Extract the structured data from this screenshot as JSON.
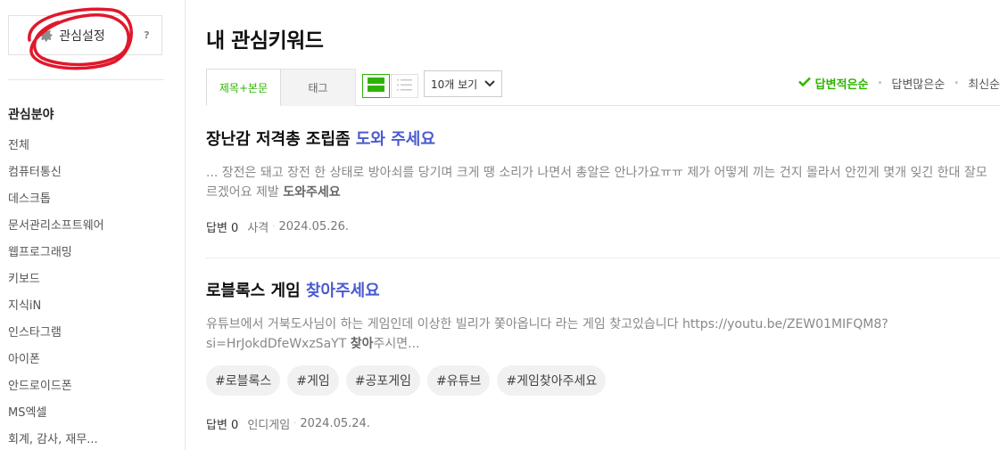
{
  "sidebar": {
    "interest_button": "관심설정",
    "help": "?",
    "category_title": "관심분야",
    "categories": [
      "전체",
      "컴퓨터통신",
      "데스크톱",
      "문서관리소프트웨어",
      "웹프로그래밍",
      "키보드",
      "지식iN",
      "인스타그램",
      "아이폰",
      "안드로이드폰",
      "MS엑셀",
      "회계, 감사, 재무..."
    ]
  },
  "main": {
    "title": "내 관심키워드",
    "tabs": {
      "title_body": "제목+본문",
      "tag": "태그"
    },
    "view_count": "10개 보기",
    "sorts": [
      "답변적은순",
      "답변많은순",
      "최신순"
    ]
  },
  "posts": [
    {
      "title_plain": "장난감 저격총 조립좀 ",
      "title_hl": "도와 주세요",
      "snippet_plain": "... 장전은 돼고 장전 한 상태로 방아쇠를 당기며 크게 땡 소리가 나면서 총알은 안나가요ㅠㅠ 제가 어떻게 끼는 건지 몰라서 안낀게 몇개 잊긴 한대 잘모르겠어요 제발 ",
      "snippet_bold": "도와주세요",
      "answers": "답변 0",
      "category": "사격",
      "date": "2024.05.26."
    },
    {
      "title_plain": "로블록스 게임 ",
      "title_hl": "찾아주세요",
      "snippet_plain": "유튜브에서 거북도사님이 하는 게임인데 이상한 빌리가 쫓아옵니다 라는 게임 찾고있습니다 https://youtu.be/ZEW01MIFQM8?si=HrJokdDfeWxzSaYT ",
      "snippet_bold": "찾아",
      "snippet_tail": "주시면...",
      "tags": [
        "#로블록스",
        "#게임",
        "#공포게임",
        "#유튜브",
        "#게임찾아주세요"
      ],
      "answers": "답변 0",
      "category": "인디게임",
      "date": "2024.05.24."
    }
  ],
  "colors": {
    "accent_green": "#2eb400",
    "highlight_blue": "#4a5bd0",
    "annotation_red": "#e0182b"
  }
}
